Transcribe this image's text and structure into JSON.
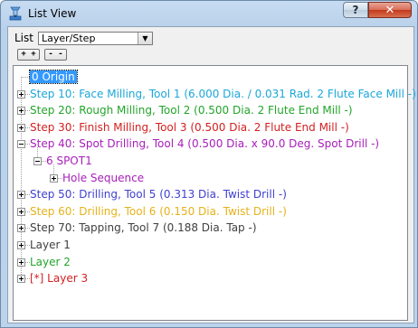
{
  "window": {
    "title": "List View",
    "help_label": "?",
    "close_label": "✕",
    "app_icon": "cnc-machine-icon"
  },
  "toolbar": {
    "list_label": "List",
    "list_select_value": "Layer/Step",
    "expand_all_label": "+ +",
    "collapse_all_label": "- -"
  },
  "tree": {
    "nodes": [
      {
        "label": "0 Origin",
        "color": "#000000",
        "selected": true,
        "expander": "none"
      },
      {
        "label": "Step 10: Face Milling, Tool 1 (6.000 Dia. / 0.031 Rad. 2 Flute Face Mill -)",
        "color": "#1ba7d8",
        "expander": "plus"
      },
      {
        "label": "Step 20: Rough Milling, Tool 2 (0.500 Dia. 2 Flute End Mill -)",
        "color": "#22a52a",
        "expander": "plus"
      },
      {
        "label": "Step 30: Finish Milling, Tool 3 (0.500 Dia. 2 Flute End Mill -)",
        "color": "#d42020",
        "expander": "plus"
      },
      {
        "label": "Step 40: Spot Drilling, Tool 4 (0.500 Dia. x 90.0 Deg. Spot Drill -)",
        "color": "#a71fba",
        "expander": "minus"
      },
      {
        "label": "6 SPOT1",
        "color": "#a71fba",
        "expander": "minus"
      },
      {
        "label": "Hole Sequence",
        "color": "#a71fba",
        "expander": "plus"
      },
      {
        "label": "Step 50: Drilling, Tool 5 (0.313 Dia. Twist Drill -)",
        "color": "#4040d0",
        "expander": "plus"
      },
      {
        "label": "Step 60: Drilling, Tool 6 (0.150 Dia. Twist Drill -)",
        "color": "#e6b21a",
        "expander": "plus"
      },
      {
        "label": "Step 70: Tapping, Tool 7 (0.188 Dia. Tap -)",
        "color": "#404040",
        "expander": "plus"
      },
      {
        "label": "Layer 1",
        "color": "#404040",
        "expander": "plus"
      },
      {
        "label": "Layer 2",
        "color": "#22a52a",
        "expander": "plus"
      },
      {
        "label": "[*] Layer 3",
        "color": "#d42020",
        "expander": "plus"
      }
    ]
  }
}
